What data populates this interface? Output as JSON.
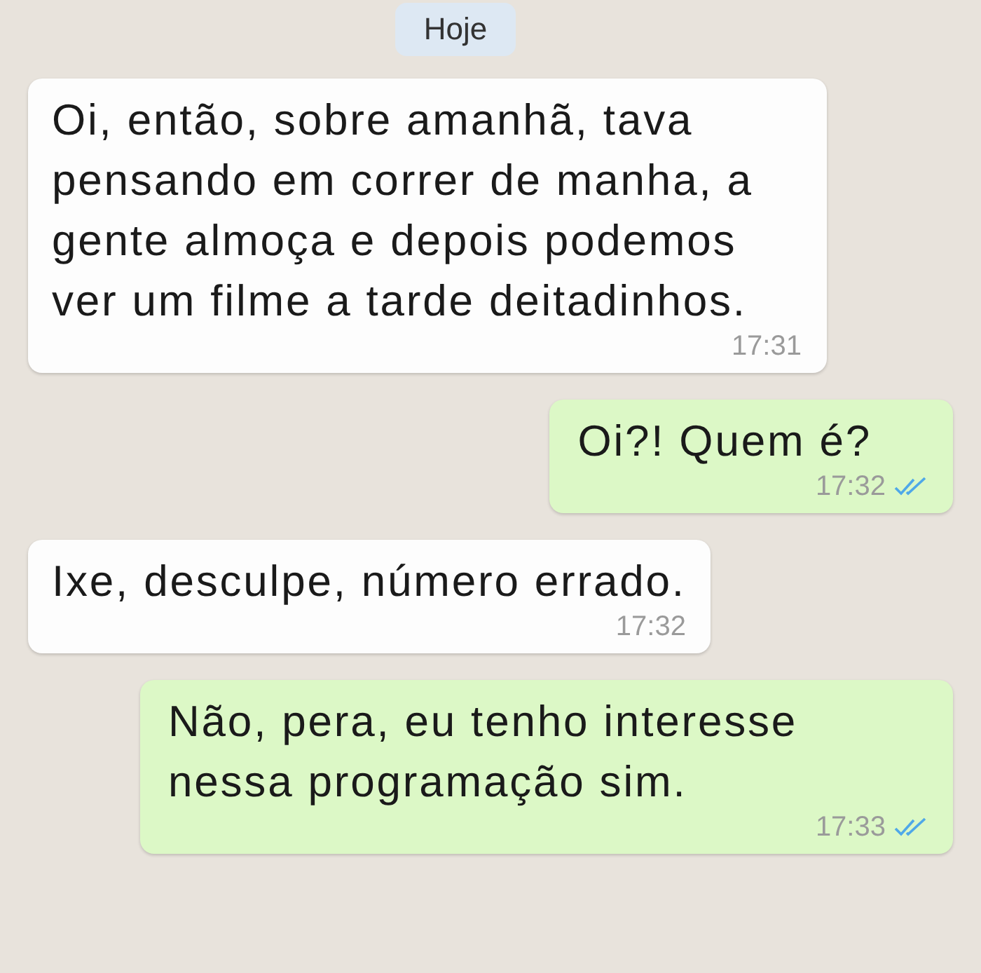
{
  "date_badge": "Hoje",
  "messages": [
    {
      "kind": "incoming",
      "text": "Oi, então, sobre amanhã, tava pensando em correr de manha, a gente almoça e depois podemos ver um filme a tarde deitadinhos.",
      "time": "17:31"
    },
    {
      "kind": "outgoing",
      "text": "Oi?! Quem é?",
      "time": "17:32",
      "read": true
    },
    {
      "kind": "incoming",
      "text": "Ixe, desculpe, número errado.",
      "time": "17:32"
    },
    {
      "kind": "outgoing",
      "text": "Não, pera, eu tenho interesse nessa programação sim.",
      "time": "17:33",
      "read": true
    }
  ]
}
